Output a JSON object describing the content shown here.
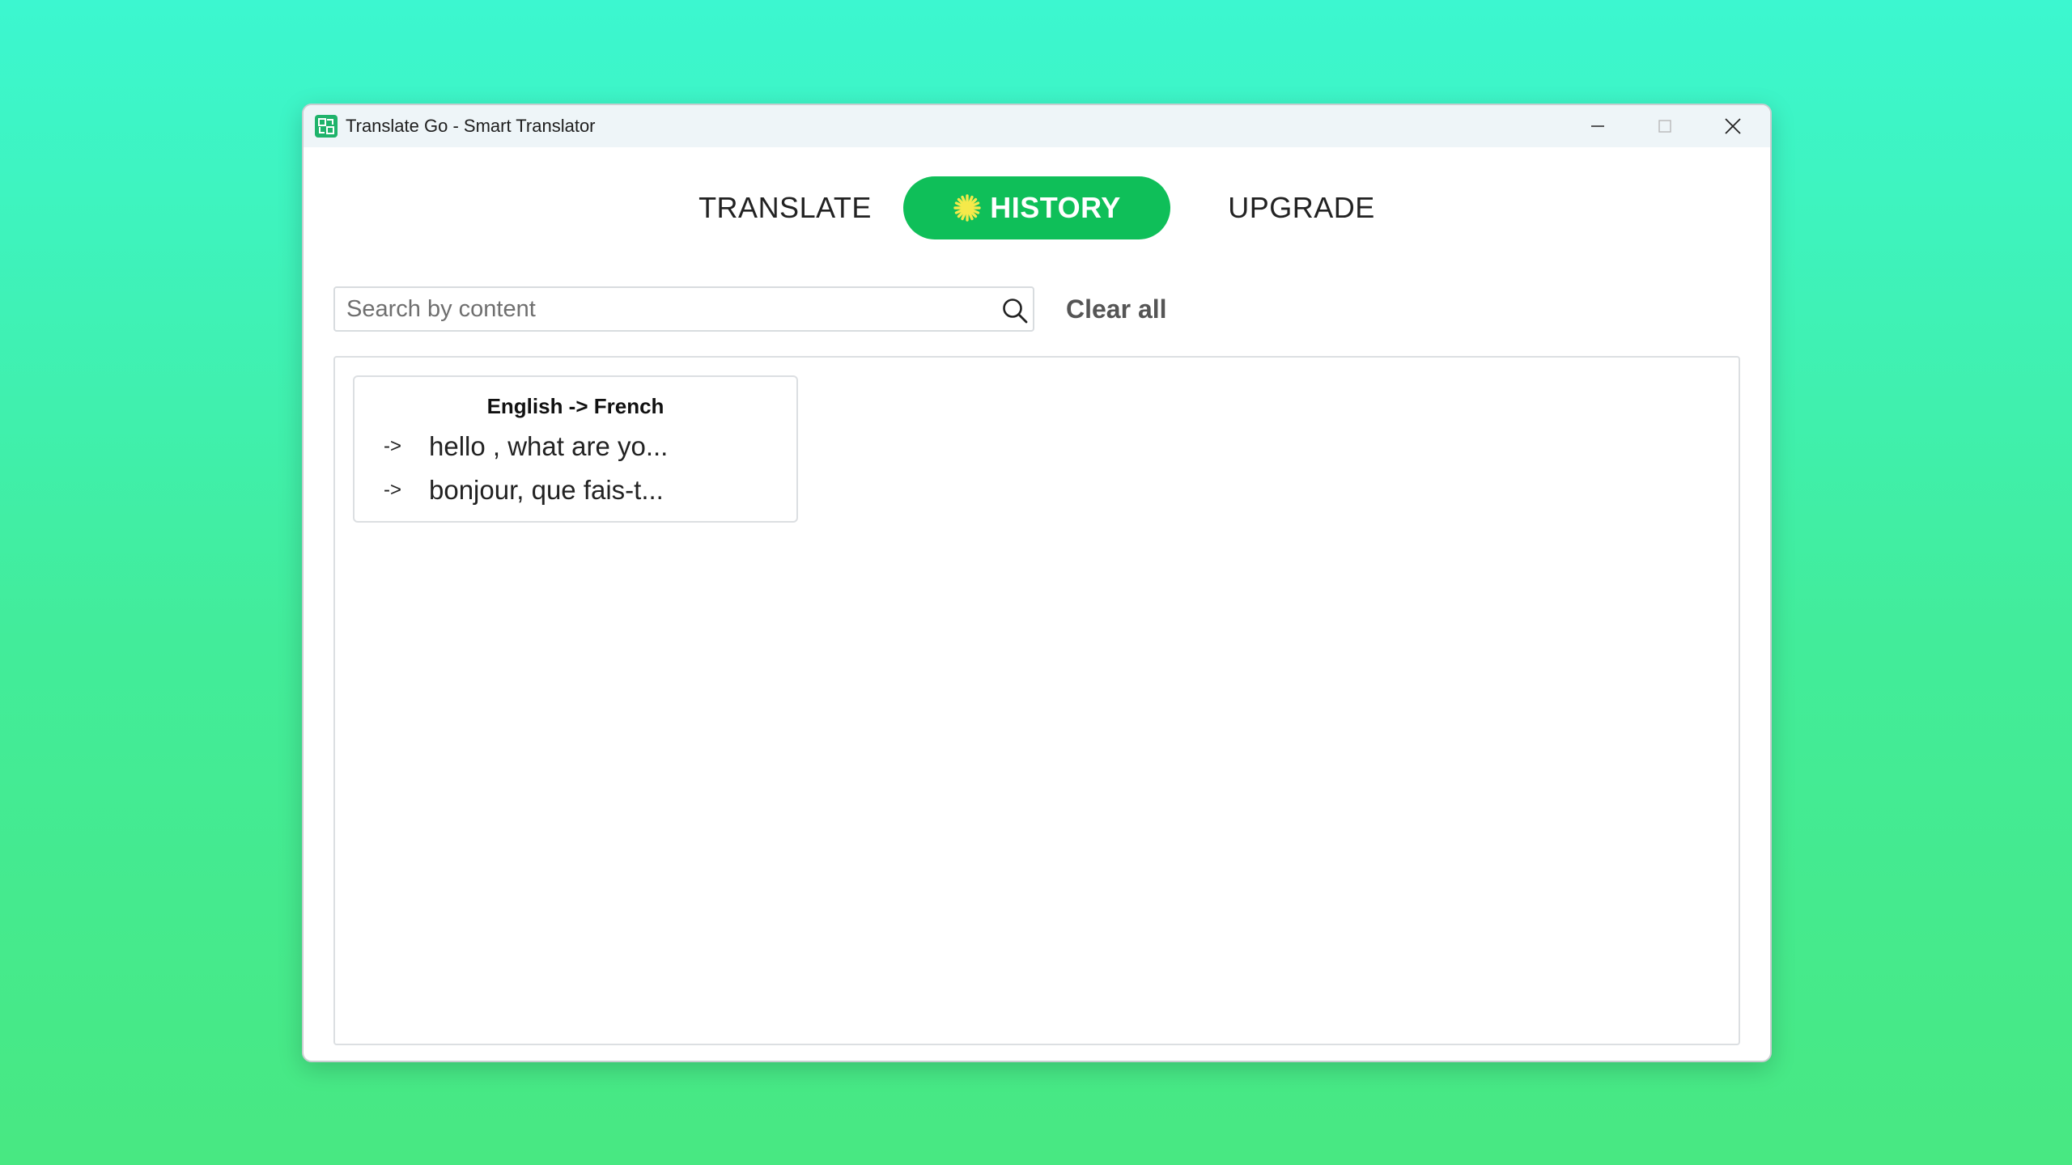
{
  "window": {
    "title": "Translate Go - Smart Translator"
  },
  "tabs": [
    {
      "label": "TRANSLATE",
      "active": false
    },
    {
      "label": "HISTORY",
      "active": true
    },
    {
      "label": "UPGRADE",
      "active": false
    }
  ],
  "search": {
    "placeholder": "Search by content",
    "value": ""
  },
  "clear_all_label": "Clear all",
  "history_items": [
    {
      "languages": "English -> French",
      "arrow": "->",
      "source_text": "hello , what are yo...",
      "translated_text": "bonjour, que fais-t..."
    }
  ],
  "colors": {
    "accent": "#0fbf59",
    "background_top": "#3cf7d0",
    "background_bottom": "#48e882"
  },
  "icons": [
    "app-logo-icon",
    "minimize-icon",
    "maximize-icon",
    "close-icon",
    "sparkle-icon",
    "search-icon"
  ]
}
